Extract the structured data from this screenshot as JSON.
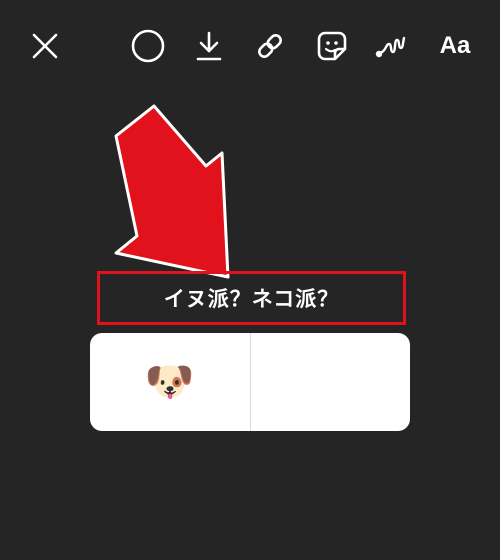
{
  "toolbar": {
    "close_icon": "close-icon",
    "shape_icon": "circle-icon",
    "download_icon": "download-icon",
    "link_icon": "link-icon",
    "sticker_icon": "sticker-icon",
    "draw_icon": "squiggle-draw-icon",
    "text_label": "Aa"
  },
  "annotation": {
    "arrow_color": "#e1121b",
    "highlight_color": "#e1121b"
  },
  "poll": {
    "question": "イヌ派？ネコ派？",
    "options": [
      {
        "label": "🐶",
        "icon": "dog-face-emoji"
      },
      {
        "label": "😸",
        "icon": "grinning-cat-emoji"
      }
    ]
  },
  "colors": {
    "background": "#252525",
    "foreground": "#ffffff",
    "poll_card": "#ffffff"
  }
}
